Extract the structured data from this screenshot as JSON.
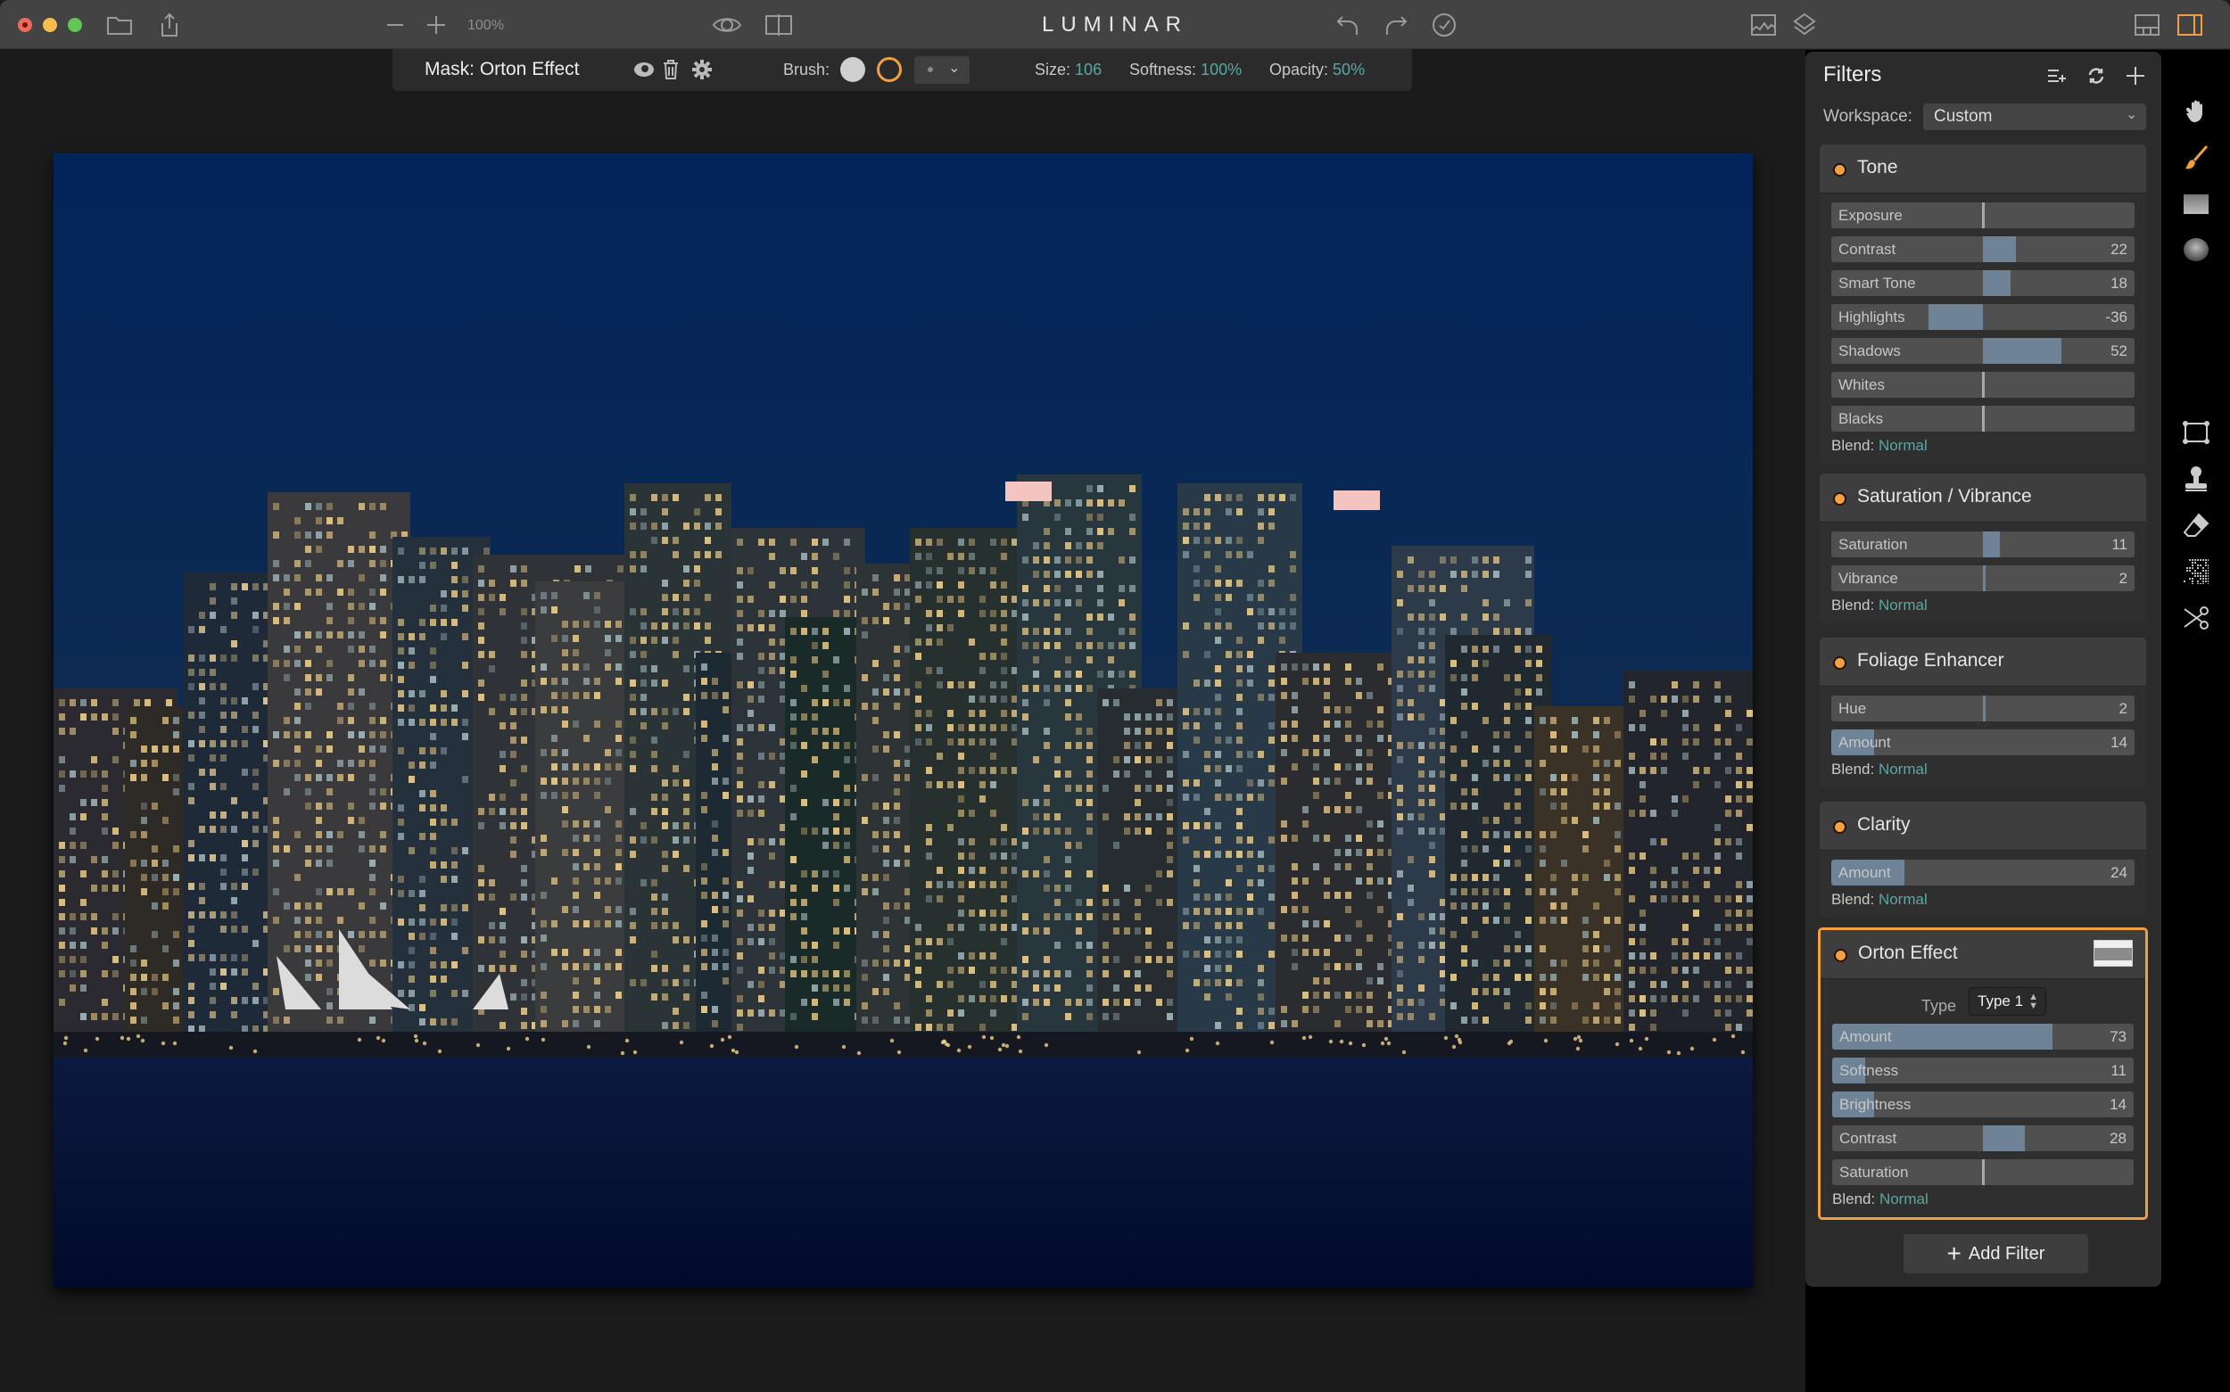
{
  "app": {
    "title": "LUMINAR",
    "zoom_level": "100%"
  },
  "titlebar": {
    "left_icons": [
      "folder-icon",
      "share-icon"
    ],
    "zoom_out": "zoom-out-icon",
    "zoom_in": "zoom-in-icon",
    "center_icons": [
      "eye-preview-icon",
      "compare-split-icon"
    ],
    "history_icons": [
      "undo-icon",
      "redo-icon",
      "history-icon"
    ],
    "right_icons": [
      "histogram-icon",
      "layers-icon",
      "filmstrip-layout-icon",
      "sidebar-layout-icon"
    ],
    "accent": "#f0a040"
  },
  "maskbar": {
    "title": "Mask: Orton Effect",
    "brush_label": "Brush:",
    "size_label": "Size:",
    "size_value": "106",
    "softness_label": "Softness:",
    "softness_value": "100%",
    "opacity_label": "Opacity:",
    "opacity_value": "50%",
    "brush_select_chevron": "⌄"
  },
  "panel": {
    "title": "Filters",
    "workspace_label": "Workspace:",
    "workspace_value": "Custom",
    "add_filter_label": "Add Filter",
    "value_color": "#5aa8a2",
    "filters": [
      {
        "name": "Tone",
        "sliders": [
          {
            "label": "Exposure",
            "value": "",
            "num": 0
          },
          {
            "label": "Contrast",
            "value": "22",
            "num": 22
          },
          {
            "label": "Smart Tone",
            "value": "18",
            "num": 18
          },
          {
            "label": "Highlights",
            "value": "-36",
            "num": -36
          },
          {
            "label": "Shadows",
            "value": "52",
            "num": 52
          },
          {
            "label": "Whites",
            "value": "",
            "num": 0
          },
          {
            "label": "Blacks",
            "value": "",
            "num": 0
          }
        ],
        "blend_label": "Blend:",
        "blend_value": "Normal"
      },
      {
        "name": "Saturation / Vibrance",
        "sliders": [
          {
            "label": "Saturation",
            "value": "11",
            "num": 11
          },
          {
            "label": "Vibrance",
            "value": "2",
            "num": 2
          }
        ],
        "blend_label": "Blend:",
        "blend_value": "Normal"
      },
      {
        "name": "Foliage Enhancer",
        "sliders": [
          {
            "label": "Hue",
            "value": "2",
            "num": 2
          },
          {
            "label": "Amount",
            "value": "14",
            "num": 14,
            "unipolar": true
          }
        ],
        "blend_label": "Blend:",
        "blend_value": "Normal"
      },
      {
        "name": "Clarity",
        "sliders": [
          {
            "label": "Amount",
            "value": "24",
            "num": 24,
            "unipolar": true
          }
        ],
        "blend_label": "Blend:",
        "blend_value": "Normal"
      },
      {
        "name": "Orton Effect",
        "active": true,
        "type_label": "Type",
        "type_value": "Type 1",
        "sliders": [
          {
            "label": "Amount",
            "value": "73",
            "num": 73,
            "unipolar": true
          },
          {
            "label": "Softness",
            "value": "11",
            "num": 11,
            "unipolar": true
          },
          {
            "label": "Brightness",
            "value": "14",
            "num": 14,
            "unipolar": true
          },
          {
            "label": "Contrast",
            "value": "28",
            "num": 28
          },
          {
            "label": "Saturation",
            "value": "",
            "num": 0
          }
        ],
        "blend_label": "Blend:",
        "blend_value": "Normal"
      }
    ]
  },
  "tools": [
    "hand-icon",
    "brush-icon",
    "gradient-icon",
    "radial-gradient-icon",
    "crop-icon",
    "clone-stamp-icon",
    "eraser-icon",
    "denoise-icon",
    "scissors-icon"
  ],
  "photo": {
    "description": "Night city skyline over water"
  }
}
